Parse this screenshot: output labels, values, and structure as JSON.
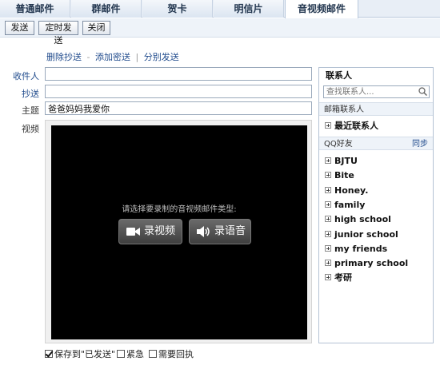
{
  "tabs": [
    {
      "label": "普通邮件",
      "active": false
    },
    {
      "label": "群邮件",
      "active": false
    },
    {
      "label": "贺卡",
      "active": false
    },
    {
      "label": "明信片",
      "active": false
    },
    {
      "label": "音视频邮件",
      "active": true
    }
  ],
  "toolbar": {
    "send_label": "发送",
    "scheduled_send_label": "定时发送",
    "close_label": "关闭"
  },
  "links": {
    "remove_cc": "删除抄送",
    "sep1": "-",
    "add_bcc": "添加密送",
    "sep2": "|",
    "separate_send": "分别发送"
  },
  "form": {
    "to_label": "收件人",
    "to_value": "",
    "cc_label": "抄送",
    "cc_value": "",
    "subject_label": "主题",
    "subject_value": "爸爸妈妈我爱你",
    "video_label": "视频"
  },
  "video": {
    "prompt": "请选择要录制的音视频邮件类型:",
    "record_video_label": "录视频",
    "record_audio_label": "录语音"
  },
  "options": {
    "save_sent_label": "保存到\"已发送\"",
    "save_sent_checked": true,
    "urgent_label": "紧急",
    "urgent_checked": false,
    "receipt_label": "需要回执",
    "receipt_checked": false
  },
  "contacts": {
    "title": "联系人",
    "search_placeholder": "查找联系人...",
    "mail_section_label": "邮箱联系人",
    "recent_label": "最近联系人",
    "qq_section_label": "QQ好友",
    "sync_label": "同步",
    "groups": [
      "BJTU",
      "Bite",
      "Honey.",
      "family",
      "high school",
      "junior school",
      "my friends",
      "primary school",
      "考研"
    ]
  }
}
